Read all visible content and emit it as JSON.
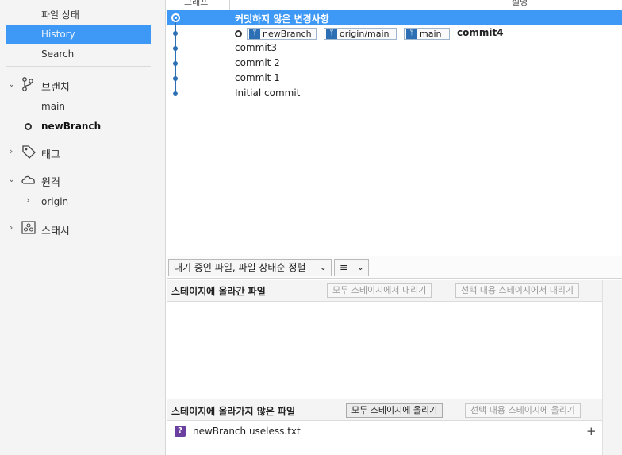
{
  "sidebar": {
    "file_status": "파일 상태",
    "history": "History",
    "search": "Search",
    "branches": {
      "title": "브랜치",
      "items": [
        "main",
        "newBranch"
      ]
    },
    "tags": {
      "title": "태그"
    },
    "remotes": {
      "title": "원격",
      "items": [
        "origin"
      ]
    },
    "stashes": {
      "title": "스태시"
    }
  },
  "graph": {
    "col_graph": "그래프",
    "col_desc": "설명",
    "uncommitted": "커밋하지 않은 변경사항",
    "refs": [
      "newBranch",
      "origin/main",
      "main"
    ],
    "commits": [
      "commit4",
      "commit3",
      "commit 2",
      "commit 1",
      "Initial commit"
    ]
  },
  "toolbar": {
    "filter_label": "대기 중인 파일, 파일 상태순 정렬",
    "list_icon": "list-icon"
  },
  "staged": {
    "title": "스테이지에 올라간 파일",
    "unstage_all": "모두 스테이지에서 내리기",
    "unstage_selected": "선택 내용 스테이지에서 내리기"
  },
  "unstaged": {
    "title": "스테이지에 올라가지 않은 파일",
    "stage_all": "모두 스테이지에 올리기",
    "stage_selected": "선택 내용 스테이지에 올리기",
    "files": [
      {
        "name": "newBranch useless.txt",
        "status": "untracked"
      }
    ]
  },
  "colors": {
    "accent": "#3d99f5",
    "graph": "#2d6fb5",
    "untracked": "#6b3fa0"
  }
}
